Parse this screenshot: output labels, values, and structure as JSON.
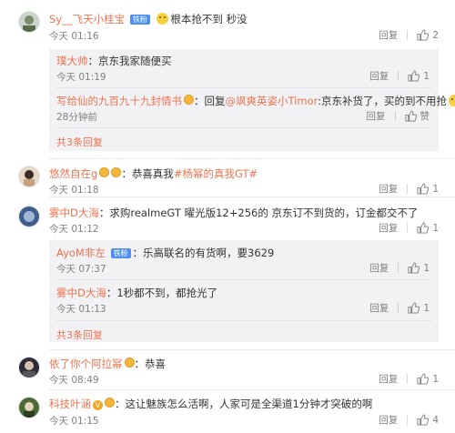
{
  "comments": [
    {
      "user": "Sy__飞天小桂宝",
      "badge": "铁粉",
      "text": "根本抢不到 秒没",
      "time": "今天 01:16",
      "reply_label": "回复",
      "likes": "2",
      "replies": [
        {
          "user": "璞大帅",
          "text": "京东我家随便买",
          "time": "今天 01:19",
          "reply_label": "回复",
          "likes": "1"
        },
        {
          "user": "写给仙的九百九十九封情书",
          "text_prefix": "回复",
          "mention": "@飒爽英姿小Timor",
          "text": ":京东补货了，买的到不用抢",
          "time": "28分钟前",
          "reply_label": "回复",
          "likes": "赞"
        }
      ],
      "more": "共3条回复"
    },
    {
      "user": "悠然自在g",
      "text": "恭喜真我",
      "hashtag": "#杨幂的真我GT#",
      "time": "今天 01:18",
      "reply_label": "回复",
      "likes": "1"
    },
    {
      "user": "雾中D大海",
      "text": "求购realmeGT 曜光版12+256的 京东订不到货的，订金都交不了",
      "time": "今天 01:12",
      "reply_label": "回复",
      "likes": "1",
      "replies": [
        {
          "user": "AyoM非左",
          "badge": "铁粉",
          "text": "乐高联名的有货啊，要3629",
          "time": "今天 07:37",
          "reply_label": "回复",
          "likes": "1"
        },
        {
          "user": "雾中D大海",
          "text": "1秒都不到，都抢光了",
          "time": "今天 01:13",
          "reply_label": "回复",
          "likes": "1"
        }
      ],
      "more": "共3条回复"
    },
    {
      "user": "依了你个阿拉幂",
      "text": "恭喜",
      "time": "今天 08:49",
      "reply_label": "回复",
      "likes": "1"
    },
    {
      "user": "科技叶涵",
      "text": "这让魅族怎么活啊，人家可是全渠道1分钟才突破的啊",
      "time": "今天 01:15",
      "reply_label": "回复",
      "likes": "4"
    }
  ],
  "colors": {
    "username": "#eb7350",
    "meta": "#808080",
    "reply_bg": "#f2f2f5"
  }
}
